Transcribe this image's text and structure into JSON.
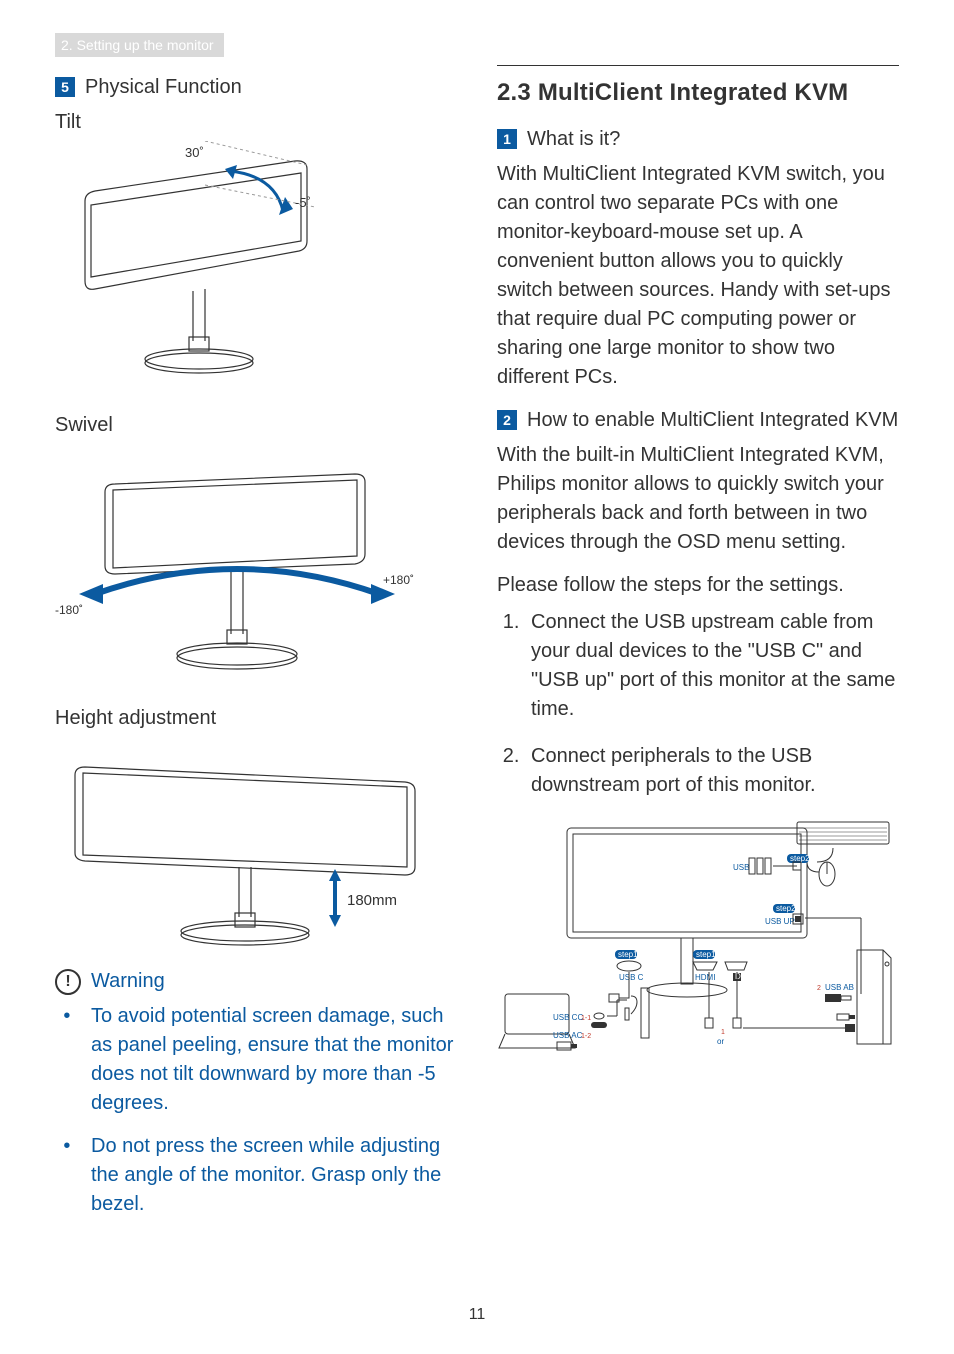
{
  "header_tab": "2. Setting up the monitor",
  "left": {
    "num5": "5",
    "physical_function": "Physical Function",
    "tilt": {
      "label": "Tilt",
      "angle_up": "30˚",
      "angle_down": "-5˚"
    },
    "swivel": {
      "label": "Swivel",
      "left": "-180˚",
      "right": "+180˚"
    },
    "height": {
      "label": "Height adjustment",
      "range": "180mm"
    },
    "warning": {
      "label": "Warning",
      "items": [
        "To avoid potential screen damage, such as panel peeling, ensure that the monitor does not tilt downward by more than -5 degrees.",
        "Do not press the screen while adjusting the angle of the monitor. Grasp only the bezel."
      ]
    }
  },
  "right": {
    "section_title": "2.3 MultiClient Integrated KVM",
    "q1": {
      "num": "1",
      "label": "What is it?"
    },
    "p1": "With MultiClient Integrated KVM switch, you can control two separate PCs with one monitor-keyboard-mouse set up. A convenient button allows you to quickly switch between sources. Handy with set-ups that require dual PC computing power or sharing one large monitor to show two different PCs.",
    "q2": {
      "num": "2",
      "label": "How to enable MultiClient Integrated KVM"
    },
    "p2": "With the built-in MultiClient Integrated KVM, Philips monitor allows to quickly switch your peripherals back and forth between in two devices through the OSD menu setting.",
    "follow": "Please follow the steps for the settings.",
    "steps": [
      "Connect the USB upstream cable from your dual devices to the \"USB C\" and \"USB up\" port of this monitor at the same time.",
      "Connect peripherals to the USB downstream port of this monitor."
    ],
    "diagram": {
      "step1_a": "step1",
      "step1_b": "step1",
      "step2": "step2",
      "usb": "USB",
      "usb_c": "USB C",
      "hdmi": "HDMI",
      "dp": "D",
      "usb_up": "USB UP",
      "usb_ab": "USB AB",
      "usb_cc": "USB CC",
      "usb_cc_n": "1-1",
      "usb_ac": "USB AC",
      "usb_ac_n": "1-2",
      "one": "1",
      "two": "2",
      "or": "or"
    }
  },
  "page_number": "11"
}
